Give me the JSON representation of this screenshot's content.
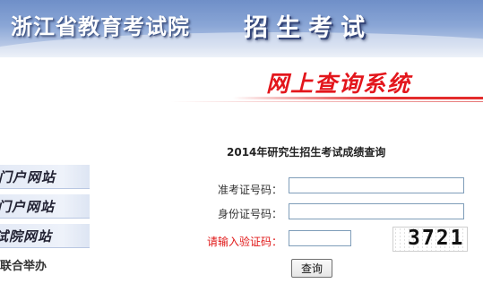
{
  "header": {
    "organization": "浙江省教育考试院",
    "department": "招生考试",
    "system_title": "网上查询系统"
  },
  "nav": {
    "items": [
      {
        "label": "门户网站"
      },
      {
        "label": "门户网站"
      },
      {
        "label": "试院网站"
      }
    ],
    "footer": "联合举办"
  },
  "form": {
    "title": "2014年研究生招生考试成绩查询",
    "exam_number_label": "准考证号码：",
    "exam_number_value": "",
    "id_number_label": "身份证号码：",
    "id_number_value": "",
    "captcha_label": "请输入验证码：",
    "captcha_value": "",
    "captcha_image_text": "3721",
    "submit_label": "查询"
  },
  "colors": {
    "banner_blue": "#7a98cf",
    "accent_red": "#e3161c",
    "label_red": "#e01818"
  }
}
